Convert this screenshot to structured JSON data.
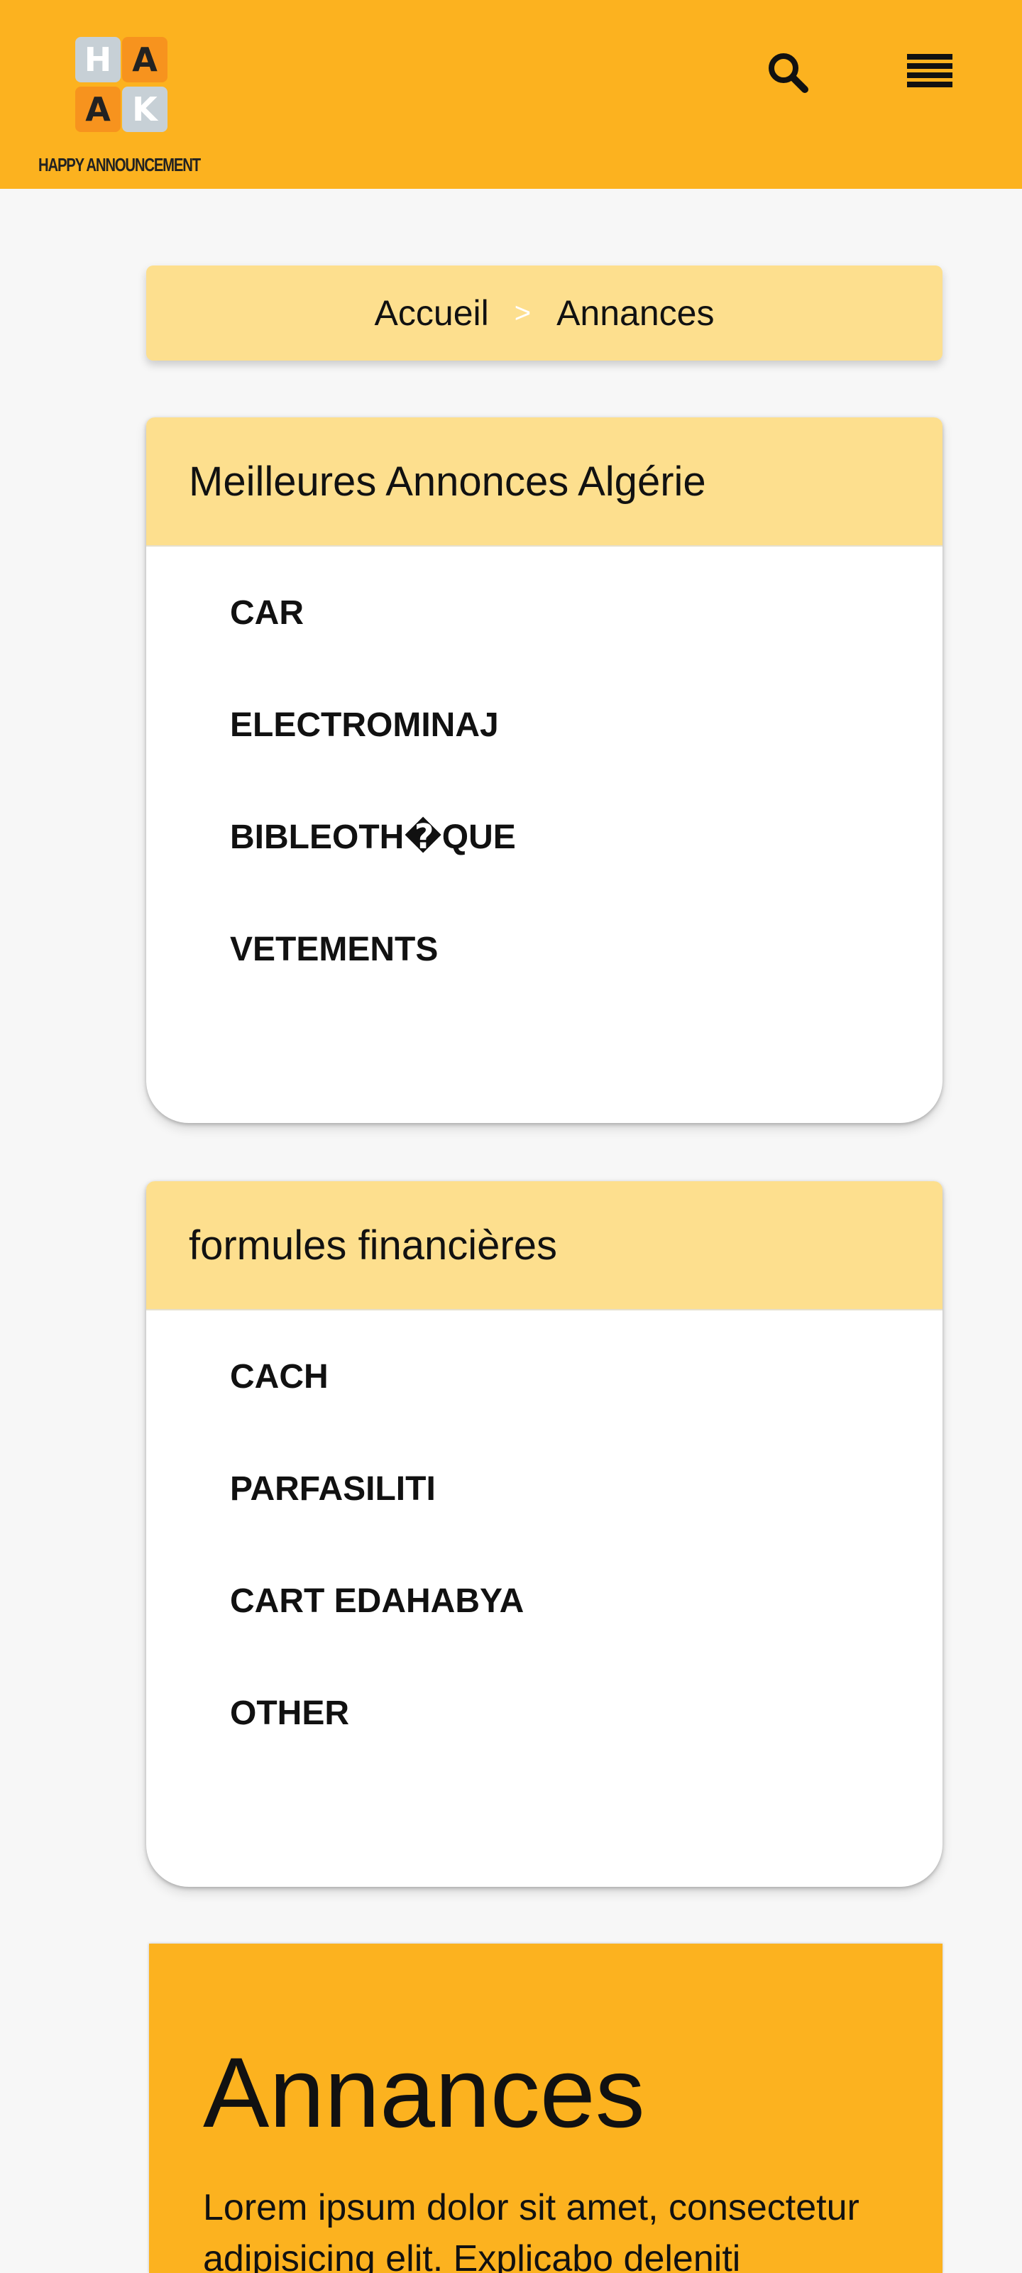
{
  "header": {
    "logo": {
      "letters": [
        "H",
        "A",
        "A",
        "K"
      ],
      "caption": "HAPPY ANNOUNCEMENT"
    },
    "search_icon": "search-icon",
    "menu_icon": "list-menu-icon",
    "background_color": "#fcb21f"
  },
  "breadcrumb": {
    "home": "Accueil",
    "separator": ">",
    "current": "Annances"
  },
  "best_ads": {
    "title": "Meilleures Annonces Algérie",
    "items": [
      "CAR",
      "ELECTROMINAJ",
      "BIBLEOTH�QUE",
      "VETEMENTS"
    ]
  },
  "financial": {
    "title": "formules financières",
    "items": [
      "CACH",
      "PARFASILITI",
      "CART EDAHABYA",
      "OTHER"
    ]
  },
  "hero": {
    "title": "Annances",
    "text": "Lorem ipsum dolor sit amet, consectetur adipisicing elit. Explicabo deleniti"
  },
  "colors": {
    "accent": "#fcb21f",
    "accent_light": "#fddf8e",
    "page_background": "#f7f7f7"
  }
}
